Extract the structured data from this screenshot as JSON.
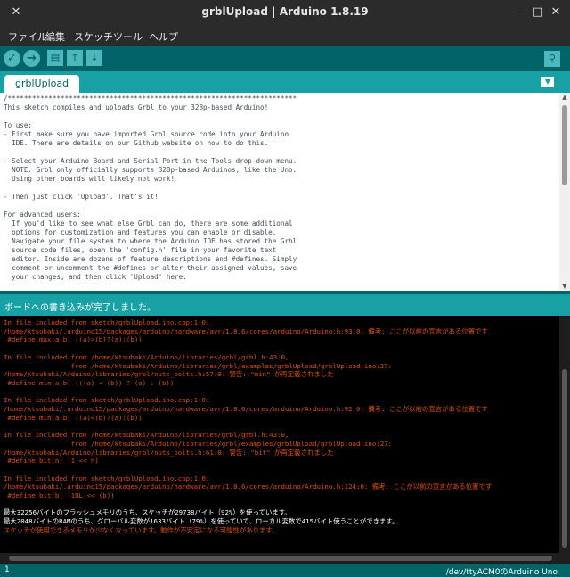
{
  "window": {
    "title": "grblUpload | Arduino 1.8.19"
  },
  "menu": [
    "ファイル",
    "編集",
    "スケッチ",
    "ツール",
    "ヘルプ"
  ],
  "toolbar": {
    "verify_icon": "check-icon",
    "upload_icon": "arrow-right-icon",
    "new_icon": "new-file-icon",
    "open_icon": "open-arrow-up-icon",
    "save_icon": "save-arrow-down-icon",
    "serial_icon": "magnifier-icon"
  },
  "tabs": [
    "grblUpload"
  ],
  "editor_lines": [
    "/***********************************************************************",
    "This sketch compiles and uploads Grbl to your 328p-based Arduino!",
    "",
    "To use:",
    "- First make sure you have imported Grbl source code into your Arduino",
    "  IDE. There are details on our Github website on how to do this.",
    "",
    "- Select your Arduino Board and Serial Port in the Tools drop-down menu.",
    "  NOTE: Grbl only officially supports 328p-based Arduinos, like the Uno.",
    "  Using other boards will likely not work!",
    "",
    "- Then just click 'Upload'. That's it!",
    "",
    "For advanced users:",
    "  If you'd like to see what else Grbl can do, there are some additional",
    "  options for customization and features you can enable or disable.",
    "  Navigate your file system to where the Arduino IDE has stored the Grbl",
    "  source code files, open the 'config.h' file in your favorite text",
    "  editor. Inside are dozens of feature descriptions and #defines. Simply",
    "  comment or uncomment the #defines or alter their assigned values, save",
    "  your changes, and then click 'Upload' here."
  ],
  "status": "ボードへの書き込みが完了しました。",
  "console_lines": [
    {
      "text": "In file included from sketch/grblUpload.ino.cpp:1:0:",
      "kind": "err"
    },
    {
      "text": "/home/ktsubaki/.arduino15/packages/arduino/hardware/avr/1.8.6/cores/arduino/Arduino.h:93:0: 備考: ここが以前の宣言がある位置です",
      "kind": "err"
    },
    {
      "text": " #define max(a,b) ((a)>(b)?(a):(b))",
      "kind": "err"
    },
    {
      "text": "",
      "kind": "err"
    },
    {
      "text": "In file included from /home/ktsubaki/Arduino/libraries/grbl/grbl.h:43:0,",
      "kind": "err"
    },
    {
      "text": "                 from /home/ktsubaki/Arduino/libraries/grbl/examples/grblUpload/grblUpload.ino:27:",
      "kind": "err"
    },
    {
      "text": "/home/ktsubaki/Arduino/libraries/grbl/nuts_bolts.h:57:0: 警告: \"min\" が再定義されました",
      "kind": "err"
    },
    {
      "text": " #define min(a,b) (((a) < (b)) ? (a) : (b))",
      "kind": "err"
    },
    {
      "text": "",
      "kind": "err"
    },
    {
      "text": "In file included from sketch/grblUpload.ino.cpp:1:0:",
      "kind": "err"
    },
    {
      "text": "/home/ktsubaki/.arduino15/packages/arduino/hardware/avr/1.8.6/cores/arduino/Arduino.h:92:0: 備考: ここが以前の宣言がある位置です",
      "kind": "err"
    },
    {
      "text": " #define min(a,b) ((a)<(b)?(a):(b))",
      "kind": "err"
    },
    {
      "text": "",
      "kind": "err"
    },
    {
      "text": "In file included from /home/ktsubaki/Arduino/libraries/grbl/grbl.h:43:0,",
      "kind": "err"
    },
    {
      "text": "                 from /home/ktsubaki/Arduino/libraries/grbl/examples/grblUpload/grblUpload.ino:27:",
      "kind": "err"
    },
    {
      "text": "/home/ktsubaki/Arduino/libraries/grbl/nuts_bolts.h:61:0: 警告: \"bit\" が再定義されました",
      "kind": "err"
    },
    {
      "text": " #define bit(n) (1 << n)",
      "kind": "err"
    },
    {
      "text": "",
      "kind": "err"
    },
    {
      "text": "In file included from sketch/grblUpload.ino.cpp:1:0:",
      "kind": "err"
    },
    {
      "text": "/home/ktsubaki/.arduino15/packages/arduino/hardware/avr/1.8.6/cores/arduino/Arduino.h:124:0: 備考: ここが以前の宣言がある位置です",
      "kind": "err"
    },
    {
      "text": " #define bit(b) (1UL << (b))",
      "kind": "err"
    },
    {
      "text": "",
      "kind": "err"
    },
    {
      "text": "最大32256バイトのフラッシュメモリのうち、スケッチが29738バイト（92%）を使っています。",
      "kind": "ok"
    },
    {
      "text": "最大2048バイトのRAMのうち、グローバル変数が1633バイト（79%）を使っていて、ローカル変数で415バイト使うことができます。",
      "kind": "ok"
    },
    {
      "text": "スケッチが使用できるメモリが少なくなっています。動作が不安定になる可能性があります。",
      "kind": "err"
    }
  ],
  "bottom": {
    "line_number": "1",
    "board_info": "/dev/ttyACM0のArduino Uno"
  },
  "colors": {
    "teal_dark": "#006468",
    "teal": "#17a1a5",
    "error_text": "#e34c00"
  }
}
